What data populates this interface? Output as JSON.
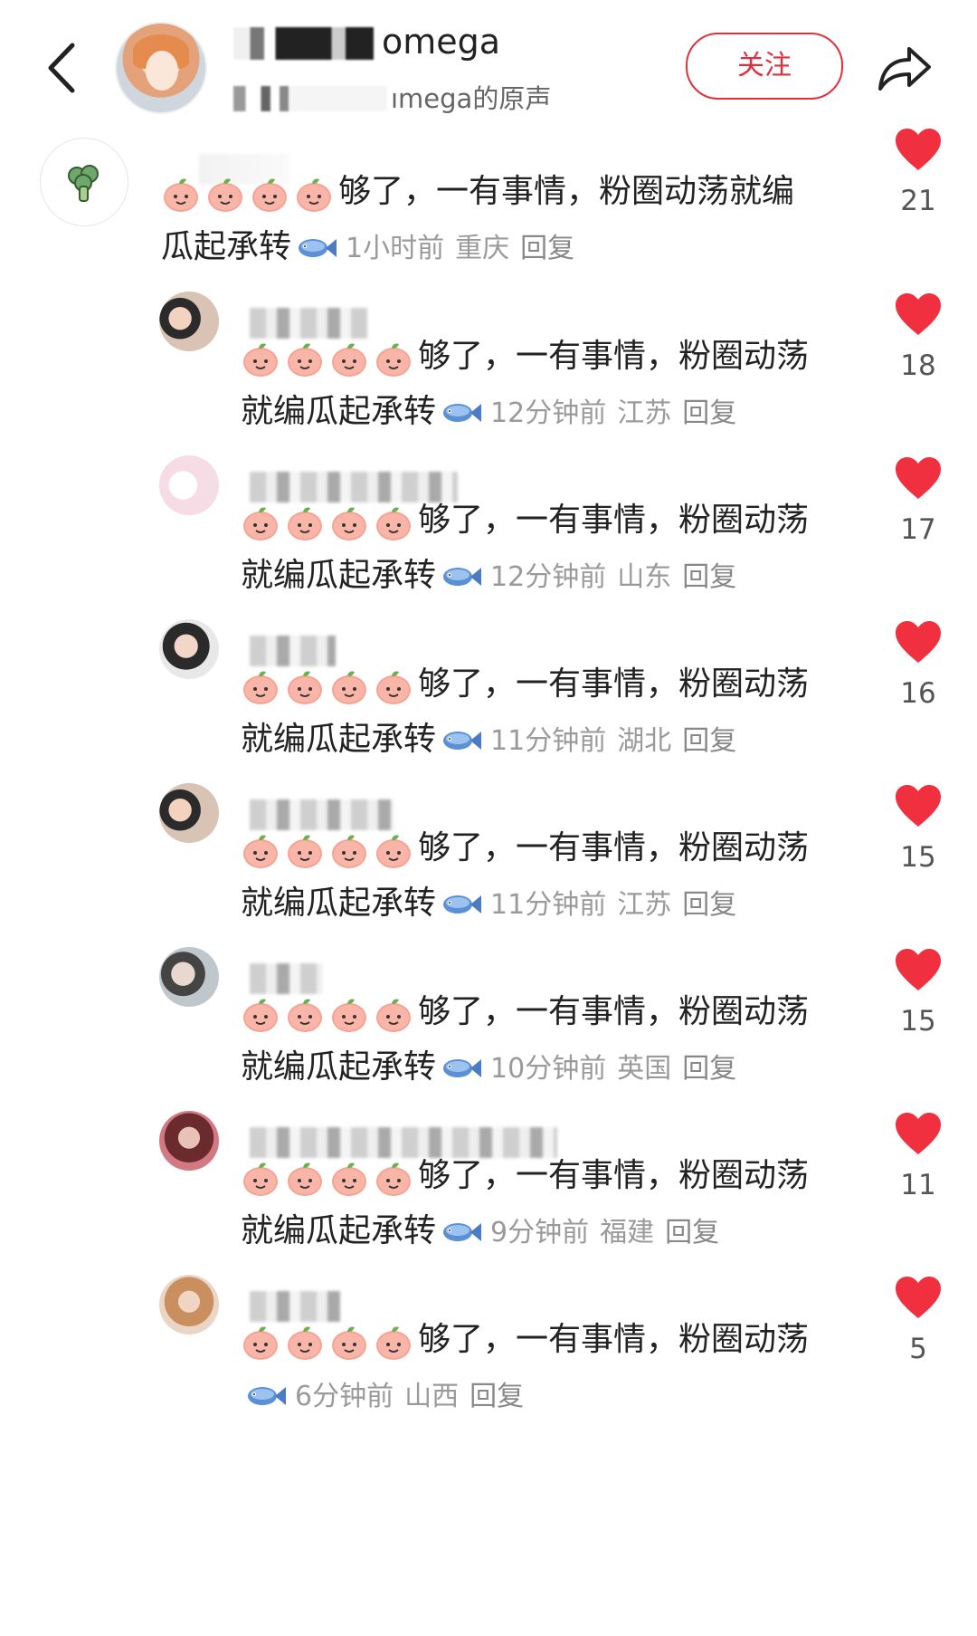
{
  "header": {
    "channel_suffix": "omega",
    "sound_text": "ımega的原声",
    "follow_label": "关注"
  },
  "comments": [
    {
      "line1": "够了，一有事情，粉圈动荡就编",
      "line2": "瓜起承转",
      "time": "1小时前",
      "location": "重庆",
      "reply": "回复",
      "likes": "21"
    },
    {
      "line1": "够了，一有事情，粉圈动荡",
      "line2": "就编瓜起承转",
      "time": "12分钟前",
      "location": "江苏",
      "reply": "回复",
      "likes": "18"
    },
    {
      "line1": "够了，一有事情，粉圈动荡",
      "line2": "就编瓜起承转",
      "time": "12分钟前",
      "location": "山东",
      "reply": "回复",
      "likes": "17"
    },
    {
      "line1": "够了，一有事情，粉圈动荡",
      "line2": "就编瓜起承转",
      "time": "11分钟前",
      "location": "湖北",
      "reply": "回复",
      "likes": "16"
    },
    {
      "line1": "够了，一有事情，粉圈动荡",
      "line2": "就编瓜起承转",
      "time": "11分钟前",
      "location": "江苏",
      "reply": "回复",
      "likes": "15"
    },
    {
      "line1": "够了，一有事情，粉圈动荡",
      "line2": "就编瓜起承转",
      "time": "10分钟前",
      "location": "英国",
      "reply": "回复",
      "likes": "15"
    },
    {
      "line1": "够了，一有事情，粉圈动荡",
      "line2": "就编瓜起承转",
      "time": "9分钟前",
      "location": "福建",
      "reply": "回复",
      "likes": "11"
    },
    {
      "line1": "够了，一有事情，粉圈动荡",
      "line2": "",
      "time": "6分钟前",
      "location": "山西",
      "reply": "回复",
      "likes": "5"
    }
  ],
  "colors": {
    "accent": "#e0303c",
    "heart": "#f0303f",
    "meta": "#9a9a9a"
  },
  "icons": {
    "back": "chevron-left-icon",
    "share": "share-arrow-icon",
    "like": "heart-icon",
    "emoji": "peach-emoji",
    "fish": "fish-emoji"
  }
}
